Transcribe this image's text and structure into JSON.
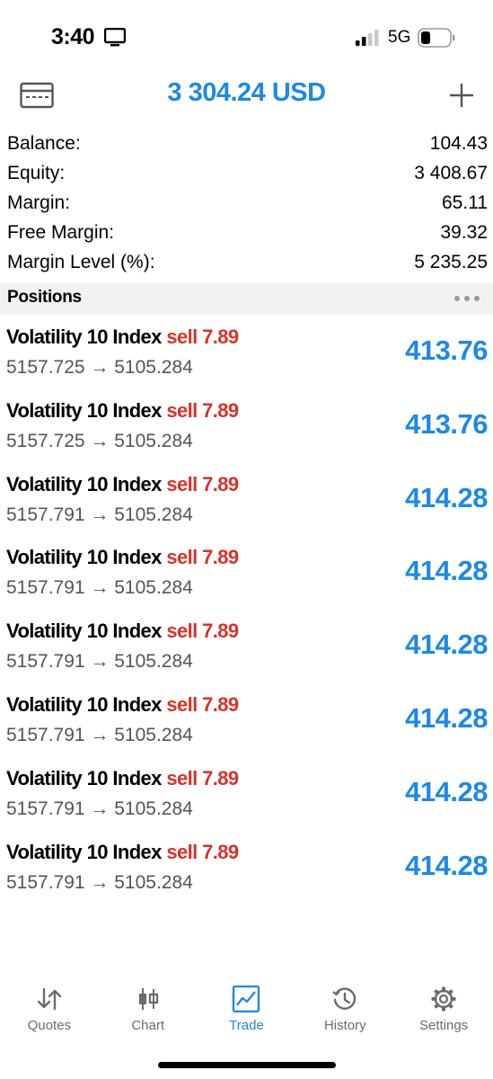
{
  "status_bar": {
    "time": "3:40",
    "network": "5G",
    "icons": [
      "screen-mirroring-icon",
      "signal-icon",
      "battery-icon"
    ]
  },
  "header": {
    "title": "3 304.24 USD",
    "left_icon": "card-icon",
    "right_icon": "plus-icon"
  },
  "summary": [
    {
      "label": "Balance:",
      "value": "104.43"
    },
    {
      "label": "Equity:",
      "value": "3 408.67"
    },
    {
      "label": "Margin:",
      "value": "65.11"
    },
    {
      "label": "Free Margin:",
      "value": "39.32"
    },
    {
      "label": "Margin Level (%):",
      "value": "5 235.25"
    }
  ],
  "positions": {
    "title": "Positions",
    "items": [
      {
        "symbol": "Volatility 10 Index",
        "side": "sell 7.89",
        "prices": "5157.725 → 5105.284",
        "profit": "413.76"
      },
      {
        "symbol": "Volatility 10 Index",
        "side": "sell 7.89",
        "prices": "5157.725 → 5105.284",
        "profit": "413.76"
      },
      {
        "symbol": "Volatility 10 Index",
        "side": "sell 7.89",
        "prices": "5157.791 → 5105.284",
        "profit": "414.28"
      },
      {
        "symbol": "Volatility 10 Index",
        "side": "sell 7.89",
        "prices": "5157.791 → 5105.284",
        "profit": "414.28"
      },
      {
        "symbol": "Volatility 10 Index",
        "side": "sell 7.89",
        "prices": "5157.791 → 5105.284",
        "profit": "414.28"
      },
      {
        "symbol": "Volatility 10 Index",
        "side": "sell 7.89",
        "prices": "5157.791 → 5105.284",
        "profit": "414.28"
      },
      {
        "symbol": "Volatility 10 Index",
        "side": "sell 7.89",
        "prices": "5157.791 → 5105.284",
        "profit": "414.28"
      },
      {
        "symbol": "Volatility 10 Index",
        "side": "sell 7.89",
        "prices": "5157.791 → 5105.284",
        "profit": "414.28"
      }
    ]
  },
  "tabs": [
    {
      "label": "Quotes",
      "icon": "quotes-icon",
      "active": false
    },
    {
      "label": "Chart",
      "icon": "chart-icon",
      "active": false
    },
    {
      "label": "Trade",
      "icon": "trade-icon",
      "active": true
    },
    {
      "label": "History",
      "icon": "history-icon",
      "active": false
    },
    {
      "label": "Settings",
      "icon": "settings-icon",
      "active": false
    }
  ],
  "colors": {
    "accent": "#1e88e5",
    "sell": "#d6322a",
    "section_bg": "#f2f2f4",
    "inactive_tab": "#6b6b6b"
  }
}
